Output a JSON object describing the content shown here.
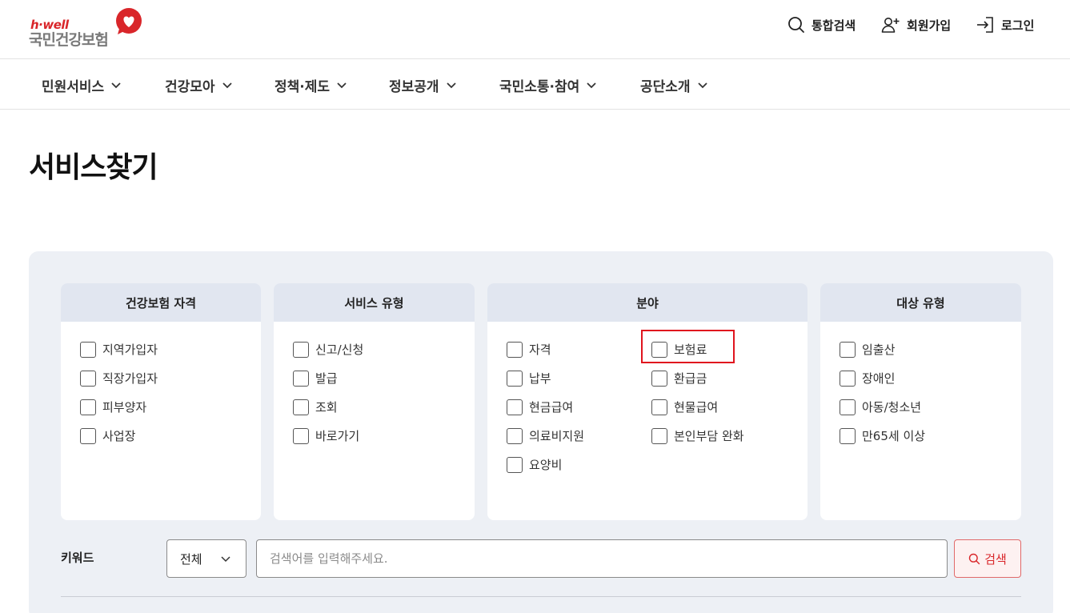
{
  "header": {
    "logo_sub": "h·well",
    "logo_name": "국민건강보험",
    "util": {
      "search_label": "통합검색",
      "join_label": "회원가입",
      "login_label": "로그인"
    }
  },
  "gnb": {
    "items": [
      {
        "label": "민원서비스"
      },
      {
        "label": "건강모아"
      },
      {
        "label": "정책·제도"
      },
      {
        "label": "정보공개"
      },
      {
        "label": "국민소통·참여"
      },
      {
        "label": "공단소개"
      }
    ]
  },
  "page": {
    "title": "서비스찾기"
  },
  "filters": {
    "qualification": {
      "title": "건강보험 자격",
      "options": [
        "지역가입자",
        "직장가입자",
        "피부양자",
        "사업장"
      ]
    },
    "service_type": {
      "title": "서비스 유형",
      "options": [
        "신고/신청",
        "발급",
        "조회",
        "바로가기"
      ]
    },
    "field": {
      "title": "분야",
      "options": [
        "자격",
        "보험료",
        "납부",
        "환급금",
        "현금급여",
        "현물급여",
        "의료비지원",
        "본인부담 완화",
        "요양비"
      ]
    },
    "target": {
      "title": "대상 유형",
      "options": [
        "임출산",
        "장애인",
        "아동/청소년",
        "만65세 이상"
      ]
    }
  },
  "keyword": {
    "label": "키워드",
    "select_value": "전체",
    "placeholder": "검색어를 입력해주세요.",
    "value": "",
    "search_button": "검색"
  },
  "colors": {
    "brand_red": "#d9262a",
    "panel_bg": "#edf0f5",
    "card_head_bg": "#e1e6f0",
    "highlight_border": "#e0141e"
  }
}
